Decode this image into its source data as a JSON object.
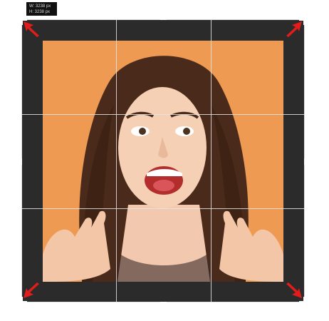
{
  "tooltip": {
    "width_text": "W: 3238 px",
    "height_text": "H: 3238 px"
  },
  "colors": {
    "canvas": "#2b2b2b",
    "photo_background": "#ee9a52",
    "grid_lines": "#e6e6e6",
    "arrows": "#e21b1b"
  },
  "icons": {
    "arrows": [
      "arrow-top-left-icon",
      "arrow-top-right-icon",
      "arrow-bottom-left-icon",
      "arrow-bottom-right-icon"
    ]
  }
}
